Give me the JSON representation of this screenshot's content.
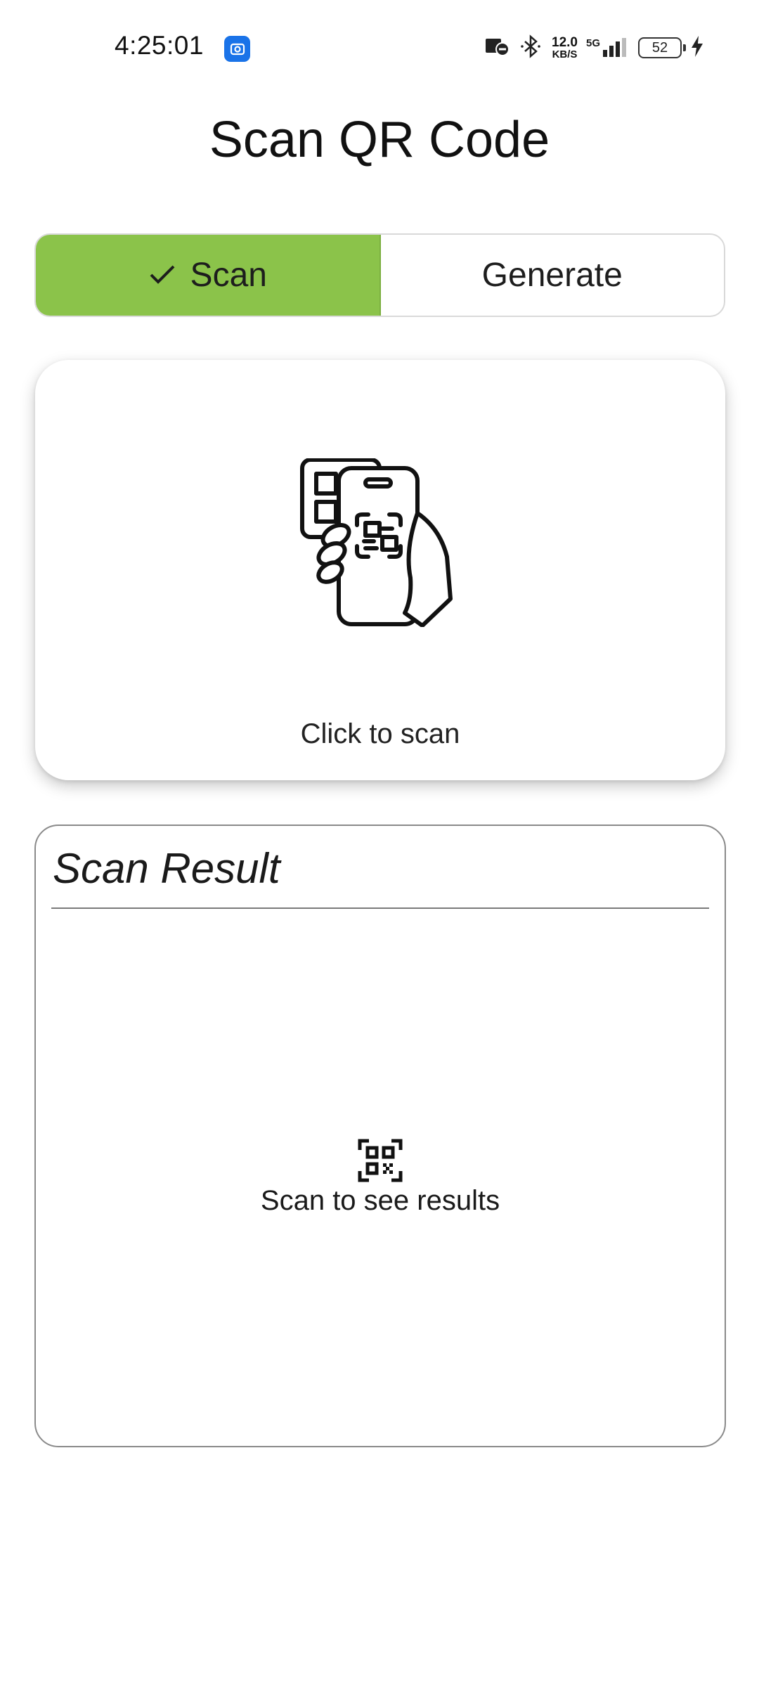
{
  "status_bar": {
    "time": "4:25:01",
    "net_speed_value": "12.0",
    "net_speed_unit": "KB/S",
    "network_type": "5G",
    "battery_level": "52"
  },
  "page": {
    "title": "Scan QR Code"
  },
  "tabs": [
    {
      "label": "Scan",
      "selected": true
    },
    {
      "label": "Generate",
      "selected": false
    }
  ],
  "scan_card": {
    "hint": "Click to scan",
    "icon": "phone-scan-qr-illustration"
  },
  "result_card": {
    "title": "Scan Result",
    "empty_text": "Scan to see results",
    "icon": "qr-code-icon"
  },
  "colors": {
    "accent": "#8bc34a",
    "app_icon_blue": "#1a73e8"
  }
}
